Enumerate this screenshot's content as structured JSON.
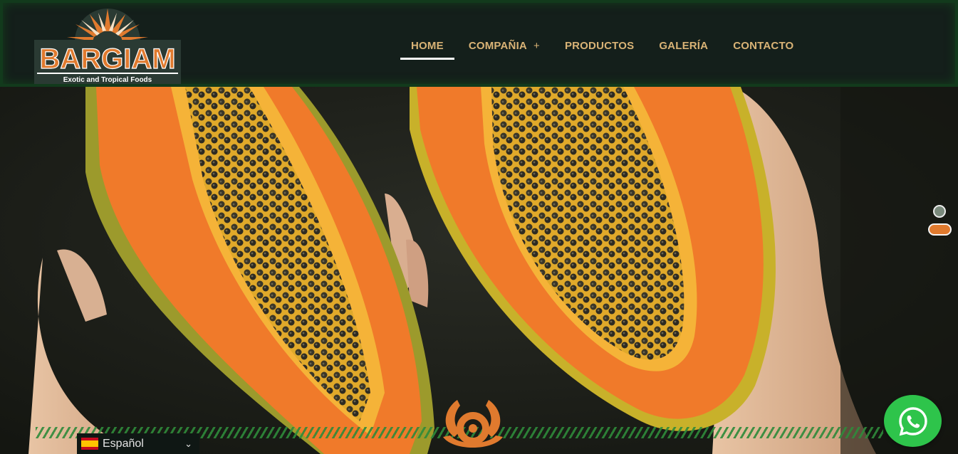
{
  "brand": {
    "name": "BARGIAM",
    "tagline": "Exotic and Tropical Foods"
  },
  "nav": {
    "items": [
      {
        "label": "HOME",
        "active": true
      },
      {
        "label": "COMPAÑIA",
        "has_submenu": true,
        "submenu_indicator": "+"
      },
      {
        "label": "PRODUCTOS"
      },
      {
        "label": "GALERÍA"
      },
      {
        "label": "CONTACTO"
      }
    ]
  },
  "hero": {
    "image": "papaya-halves-photo",
    "slider": {
      "slides": 2,
      "active_slide": 2
    }
  },
  "language": {
    "label": "Español",
    "flag": "spain-flag-icon"
  },
  "floating": {
    "whatsapp_icon": "whatsapp-icon",
    "hazard_icon": "biohazard-icon"
  },
  "colors": {
    "header_bg": "#141f1b",
    "nav_text": "#d9b376",
    "accent_orange": "#e07a2e",
    "whatsapp_green": "#2ec44b"
  }
}
